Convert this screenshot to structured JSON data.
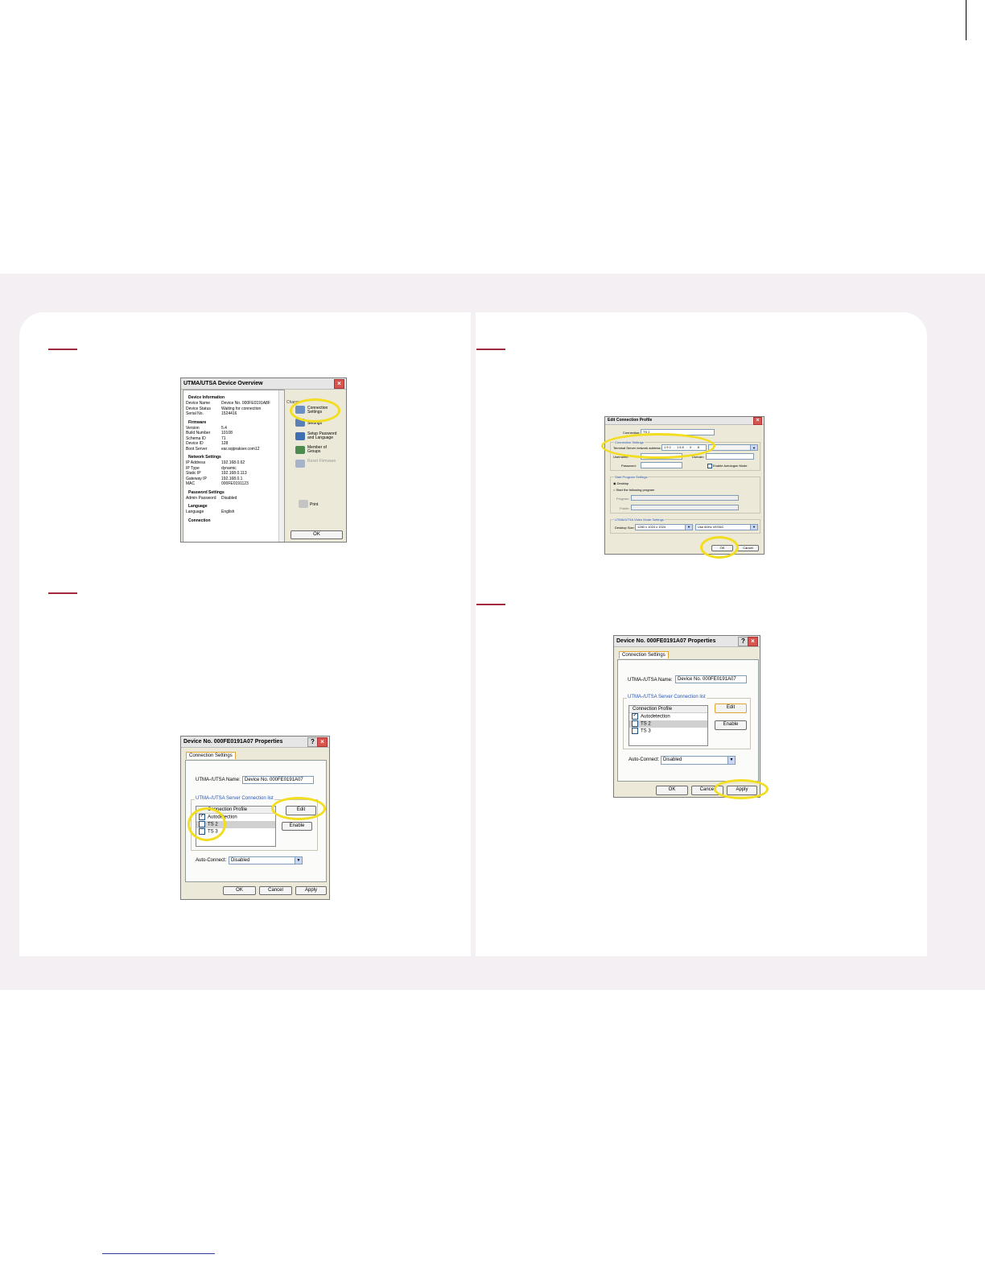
{
  "overview": {
    "title": "UTMA/UTSA Device Overview",
    "sections": [
      {
        "heading": "Device Information",
        "rows": [
          [
            "Device Name",
            "Device No. 000FE0191A8F"
          ],
          [
            "Device Status",
            "Waiting for connection"
          ],
          [
            "Serial No.",
            "1524416"
          ]
        ]
      },
      {
        "heading": "Firmware",
        "rows": [
          [
            "Version",
            "5.4"
          ],
          [
            "Build Number",
            "10108"
          ],
          [
            "Schema ID",
            "71"
          ],
          [
            "Device ID",
            "128"
          ],
          [
            "Boot Server",
            "ear.sqiprakser.com12"
          ]
        ]
      },
      {
        "heading": "Network Settings",
        "rows": [
          [
            "IP Address",
            "192.168.0.62"
          ],
          [
            "IP Type",
            "dynamic"
          ],
          [
            "Static IP",
            "192.168.0.113"
          ],
          [
            "Gateway IP",
            "192.168.0.1"
          ],
          [
            "MAC",
            "000FE0191123"
          ]
        ]
      },
      {
        "heading": "Password Settings",
        "rows": [
          [
            "Admin Password",
            "Disabled"
          ]
        ]
      },
      {
        "heading": "Language",
        "rows": [
          [
            "Language",
            "English"
          ]
        ]
      },
      {
        "heading": "Connection",
        "rows": []
      }
    ],
    "change_label": "Change",
    "actions": [
      "Connection Settings",
      "Settings",
      "Setup Password and Language",
      "Member of Groups",
      "Reset Firmware"
    ],
    "print_label": "Print",
    "ok_label": "OK"
  },
  "properties": {
    "title": "Device No. 000FE0191A07 Properties",
    "tab_label": "Connection Settings",
    "name_label": "UTMA-/UTSA Name:",
    "name_value": "Device No. 000FE0191A07",
    "group_label": "UTMA-/UTSA Server Connection list",
    "list_header": "Connection Profile",
    "items": [
      "Autodetection",
      "TS 2",
      "TS 3"
    ],
    "edit_label": "Edit",
    "enable_label": "Enable",
    "auto_label": "Auto-Connect:",
    "auto_value": "Disabled",
    "ok_label": "OK",
    "cancel_label": "Cancel",
    "apply_label": "Apply"
  },
  "edit_profile": {
    "title": "Edit Connection Profile",
    "connection_label": "Connection:",
    "connection_value": "TS 2",
    "conn_group": "Connection Settings",
    "address_label": "Terminal Server network address:",
    "ip": [
      "192",
      "168",
      "0",
      "8"
    ],
    "user_label": "Username:",
    "domain_label": "Domain:",
    "password_label": "Password:",
    "autologon_label": "Enable Autologon Mode",
    "start_group": "Start Program Settings",
    "desktop_label": "Desktop",
    "start_label": "Start the following program",
    "program_label": "Program:",
    "folder_label": "Folder:",
    "video_group": "UTMA/UTSA Video Mode Settings",
    "desktop_size_label": "Desktop Size:",
    "desktop_size_value": "1280 x 1024 x 1024",
    "vmode_value": "Use 60Hz VESNC",
    "ok_label": "OK",
    "cancel_label": "Cancel"
  }
}
